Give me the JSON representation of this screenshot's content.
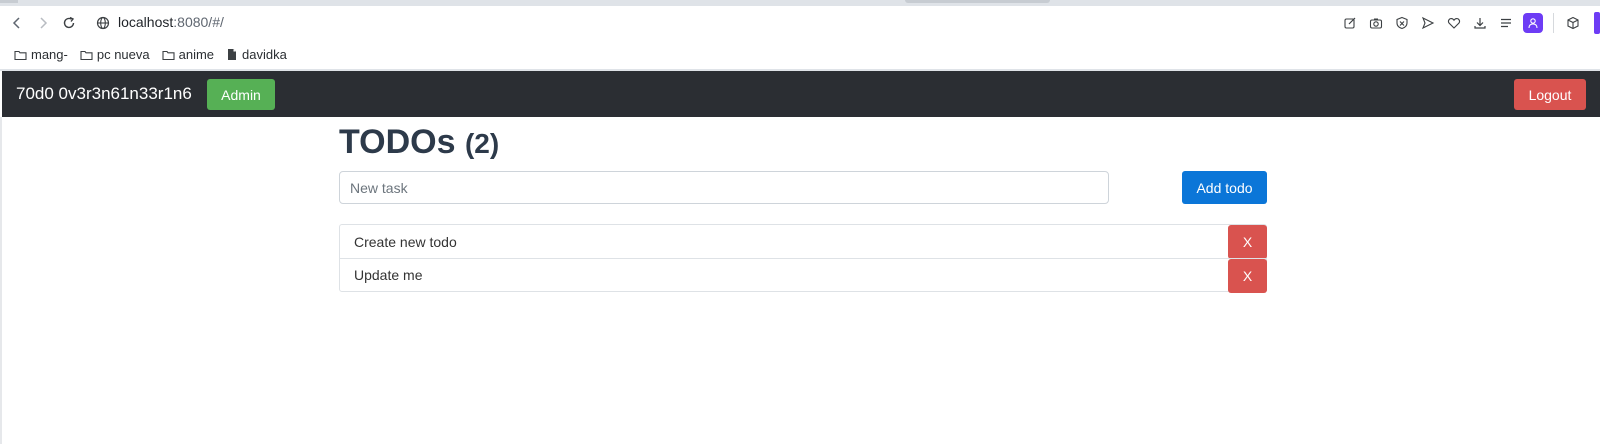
{
  "browser": {
    "url_host": "localhost",
    "url_rest": ":8080/#/",
    "bookmarks": [
      {
        "label": "mang-",
        "icon": "folder-icon"
      },
      {
        "label": "pc nueva",
        "icon": "folder-icon"
      },
      {
        "label": "anime",
        "icon": "folder-icon"
      },
      {
        "label": "davidka",
        "icon": "file-icon"
      }
    ]
  },
  "navbar": {
    "brand": "70d0 0v3r3n61n33r1n6",
    "admin_label": "Admin",
    "logout_label": "Logout",
    "colors": {
      "bar": "#2b2e33",
      "admin": "#56b055",
      "logout": "#d9534f"
    }
  },
  "main": {
    "title": "TODOs",
    "count": "(2)",
    "input_placeholder": "New task",
    "input_value": "",
    "add_label": "Add todo",
    "todos": [
      {
        "text": "Create new todo",
        "delete_label": "X"
      },
      {
        "text": "Update me",
        "delete_label": "X"
      }
    ],
    "colors": {
      "primary": "#0b76d8",
      "danger": "#d9534f"
    }
  }
}
